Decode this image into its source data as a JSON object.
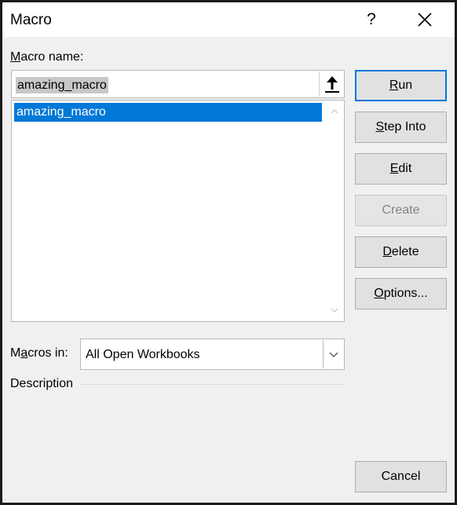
{
  "window": {
    "title": "Macro",
    "help_label": "?",
    "close_label": "close"
  },
  "macro_name": {
    "label_mnemonic": "M",
    "label_rest": "acro name:",
    "value": "amazing_macro"
  },
  "macro_list": {
    "items": [
      "amazing_macro"
    ],
    "selected_index": 0
  },
  "buttons": {
    "run": {
      "mnemonic": "R",
      "rest": "un"
    },
    "step_into": {
      "mnemonic": "S",
      "rest": "tep Into"
    },
    "edit": {
      "mnemonic": "E",
      "rest": "dit"
    },
    "create": {
      "label": "Create"
    },
    "delete": {
      "mnemonic": "D",
      "rest": "elete"
    },
    "options": {
      "mnemonic": "O",
      "rest": "ptions..."
    },
    "cancel": {
      "label": "Cancel"
    }
  },
  "macros_in": {
    "label_pre": "M",
    "label_mnemonic": "a",
    "label_rest": "cros in:",
    "value": "All Open Workbooks"
  },
  "description": {
    "label": "Description"
  },
  "colors": {
    "selection": "#0078d7",
    "default_border": "#0078d7",
    "disabled_text": "#838383"
  },
  "icons": {
    "upload": "upload-arrow-icon",
    "close": "close-icon",
    "dropdown": "chevron-down-icon"
  }
}
